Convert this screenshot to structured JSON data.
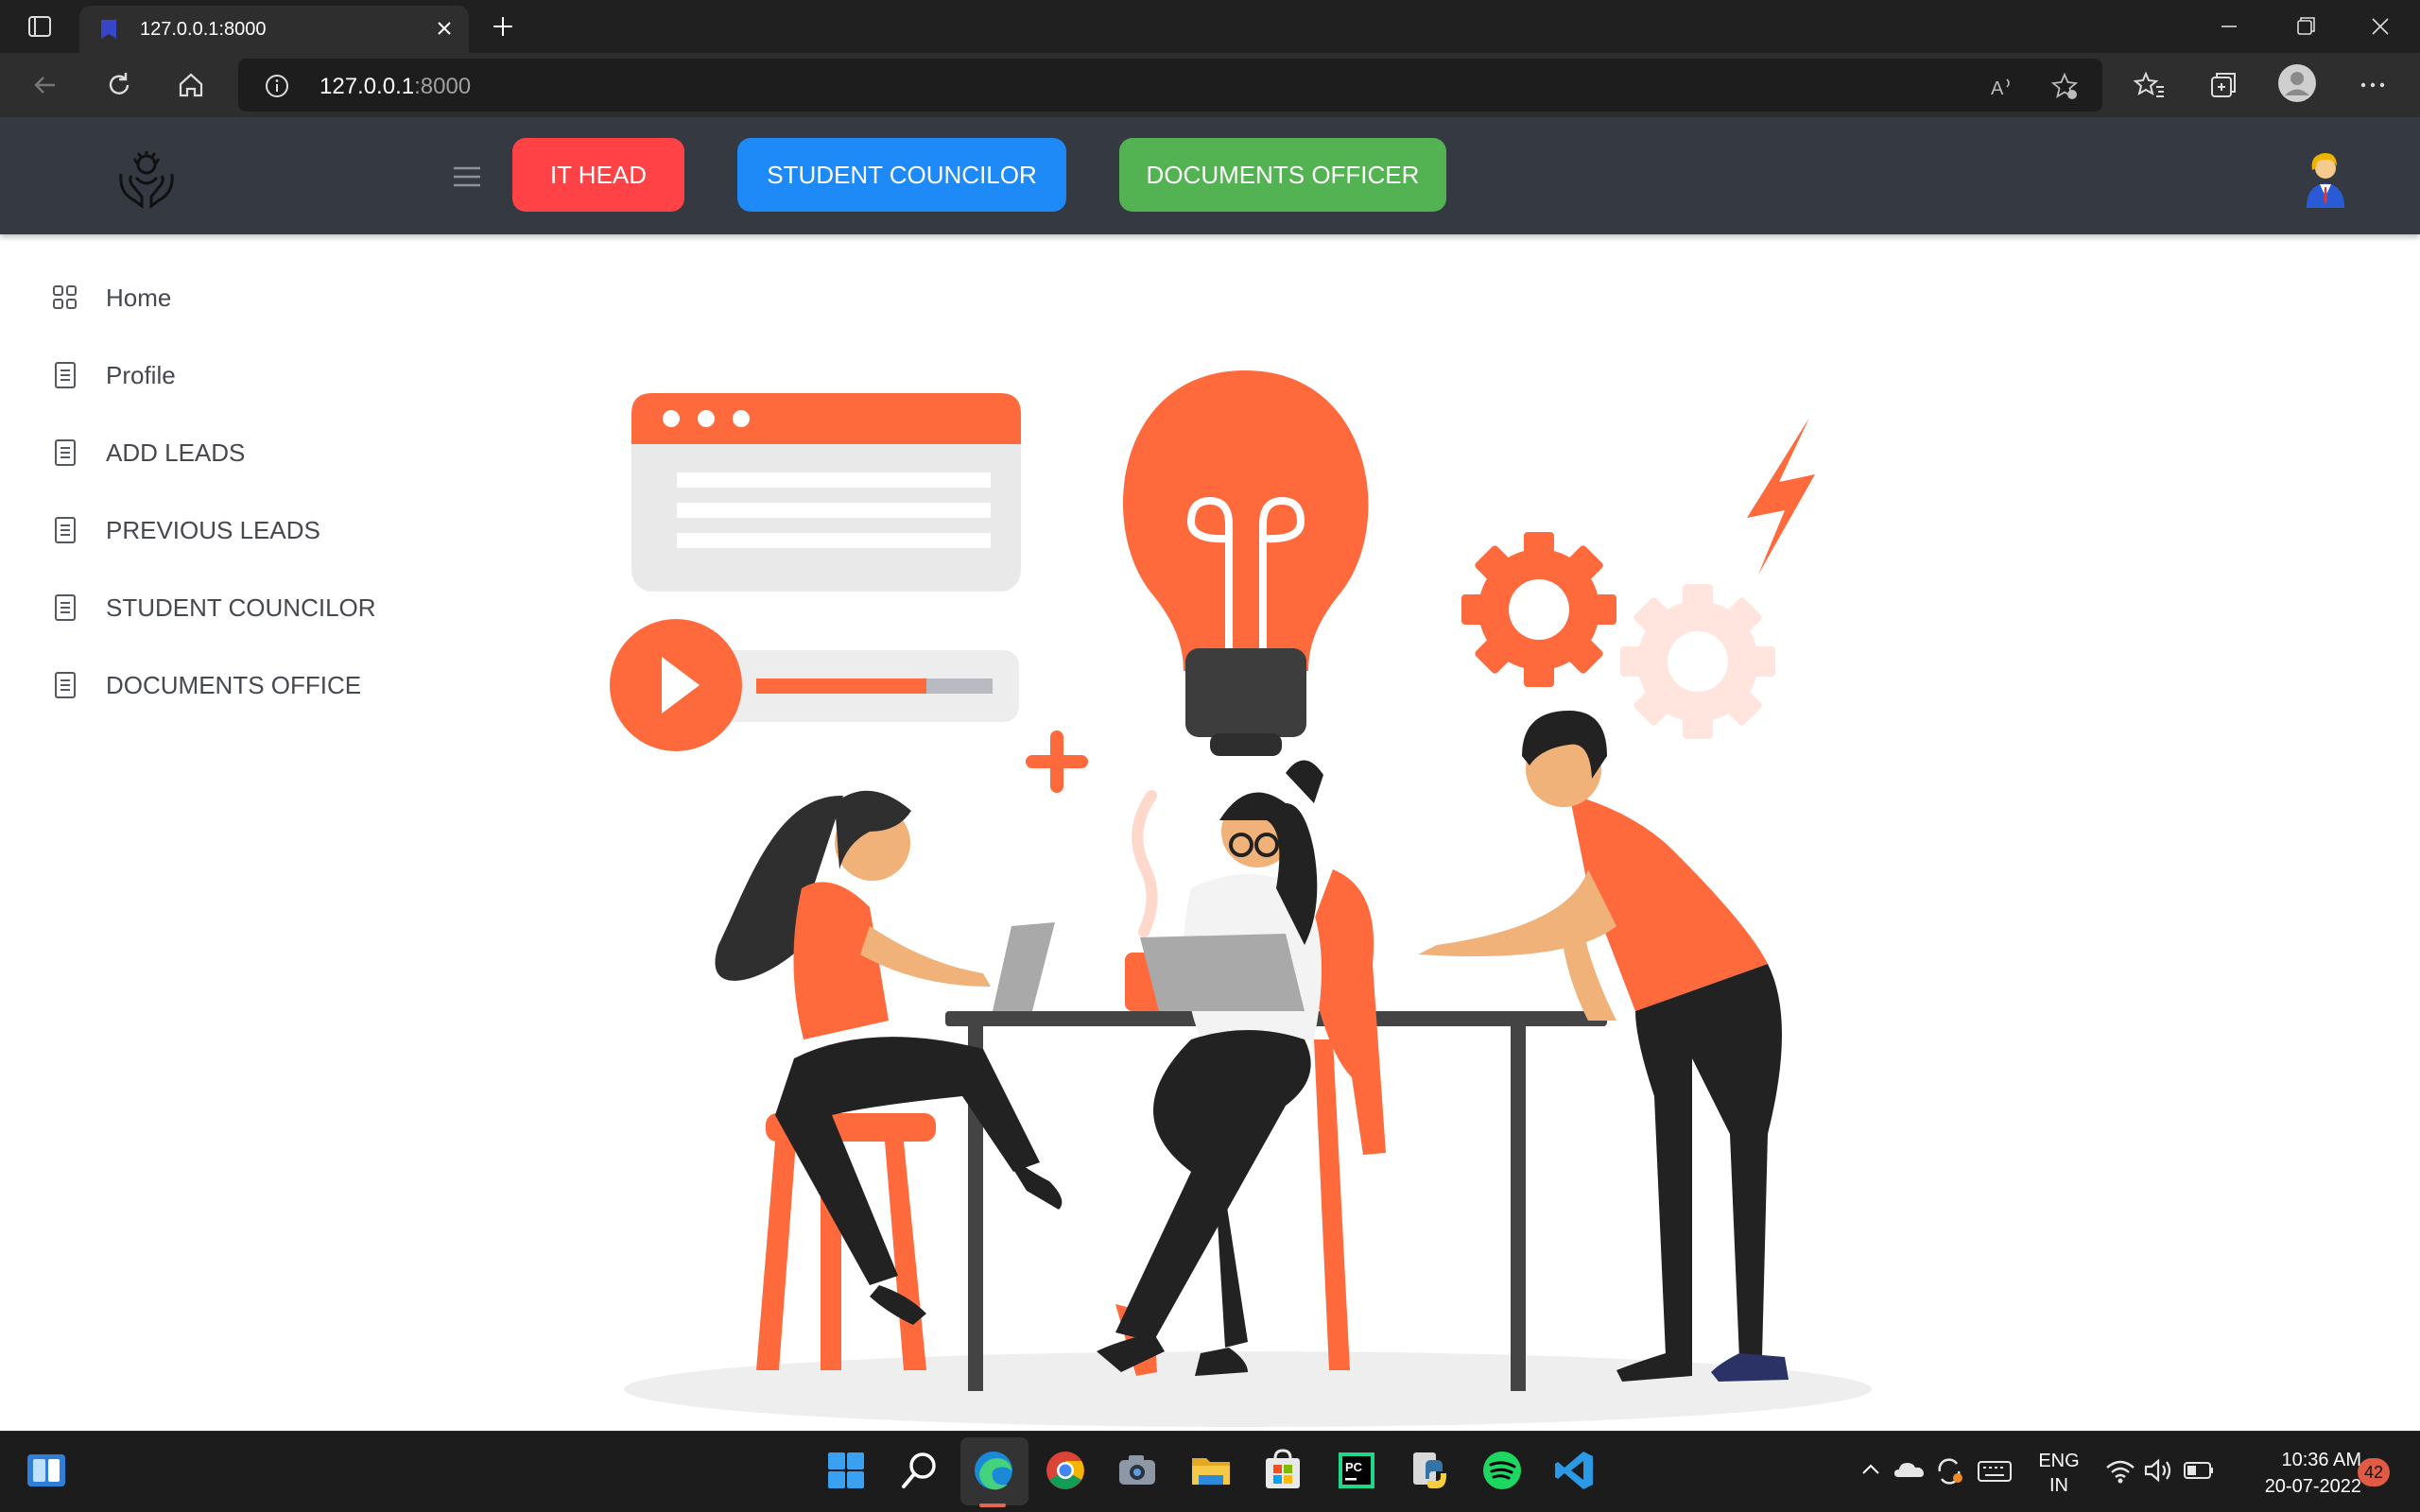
{
  "browser": {
    "tab_title": "127.0.0.1:8000",
    "url_host": "127.0.0.1",
    "url_port": ":8000"
  },
  "header": {
    "buttons": [
      {
        "label": "IT HEAD",
        "color": "#ff4246"
      },
      {
        "label": "STUDENT COUNCILOR",
        "color": "#1e8af7"
      },
      {
        "label": "DOCUMENTS OFFICER",
        "color": "#53b251"
      }
    ],
    "background": "#353a42"
  },
  "sidebar": {
    "items": [
      {
        "label": "Home",
        "icon": "grid-icon"
      },
      {
        "label": "Profile",
        "icon": "document-icon"
      },
      {
        "label": "ADD LEADS",
        "icon": "document-icon"
      },
      {
        "label": "PREVIOUS LEADS",
        "icon": "document-icon"
      },
      {
        "label": "STUDENT COUNCILOR",
        "icon": "document-icon"
      },
      {
        "label": "DOCUMENTS OFFICE",
        "icon": "document-icon"
      }
    ]
  },
  "accent_color": "#ff6a3d",
  "taskbar": {
    "language": "ENG",
    "region": "IN",
    "time": "10:36 AM",
    "date": "20-07-2022",
    "notifications": "42"
  }
}
